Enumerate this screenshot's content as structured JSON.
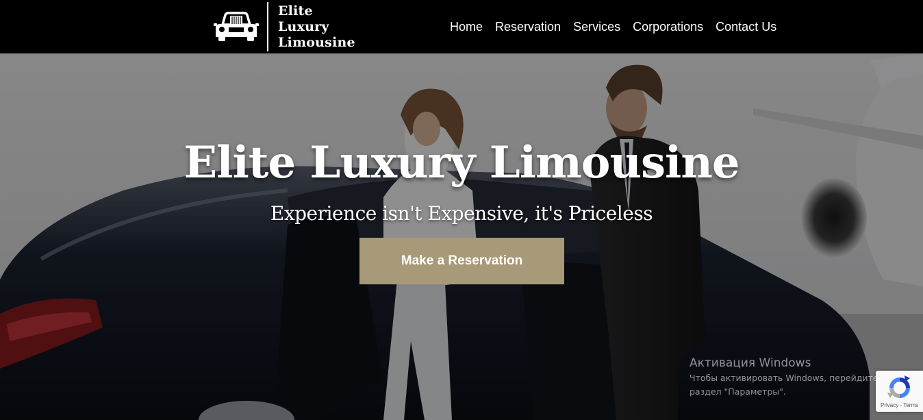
{
  "header": {
    "logo_lines": [
      "Elite",
      "Luxury",
      "Limousine"
    ],
    "nav": [
      "Home",
      "Reservation",
      "Services",
      "Corporations",
      "Contact Us"
    ]
  },
  "hero": {
    "title": "Elite Luxury Limousine",
    "subtitle": "Experience isn't Expensive, it's Priceless",
    "cta_label": "Make a Reservation",
    "background_image": "luxury-sedan-couple-private-jet-photo"
  },
  "watermark": {
    "title": "Активация Windows",
    "line1": "Чтобы активировать Windows, перейдите в",
    "line2": "раздел \"Параметры\"."
  },
  "recaptcha": {
    "privacy": "Privacy",
    "separator": " - ",
    "terms": "Terms",
    "icon": "recaptcha-icon"
  },
  "colors": {
    "header_bg": "#000000",
    "cta_bg": "#a89a78",
    "text": "#ffffff"
  }
}
